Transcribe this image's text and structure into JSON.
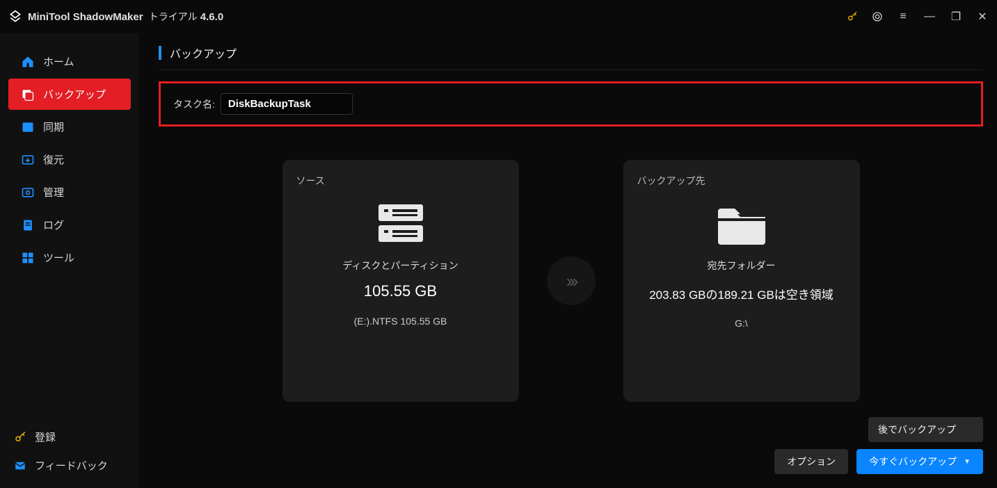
{
  "app": {
    "title": "MiniTool ShadowMaker",
    "trial": "トライアル",
    "version": "4.6.0"
  },
  "sidebar": {
    "items": [
      {
        "label": "ホーム"
      },
      {
        "label": "バックアップ"
      },
      {
        "label": "同期"
      },
      {
        "label": "復元"
      },
      {
        "label": "管理"
      },
      {
        "label": "ログ"
      },
      {
        "label": "ツール"
      }
    ],
    "register": "登録",
    "feedback": "フィードバック"
  },
  "page": {
    "title": "バックアップ"
  },
  "task": {
    "label": "タスク名:",
    "value": "DiskBackupTask"
  },
  "source": {
    "label": "ソース",
    "type_label": "ディスクとパーティション",
    "size": "105.55 GB",
    "detail": "(E:).NTFS 105.55 GB"
  },
  "destination": {
    "label": "バックアップ先",
    "folder_label": "宛先フォルダー",
    "space": "203.83 GBの189.21 GBは空き領域",
    "drive": "G:\\"
  },
  "buttons": {
    "later": "後でバックアップ",
    "options": "オプション",
    "now": "今すぐバックアップ"
  }
}
